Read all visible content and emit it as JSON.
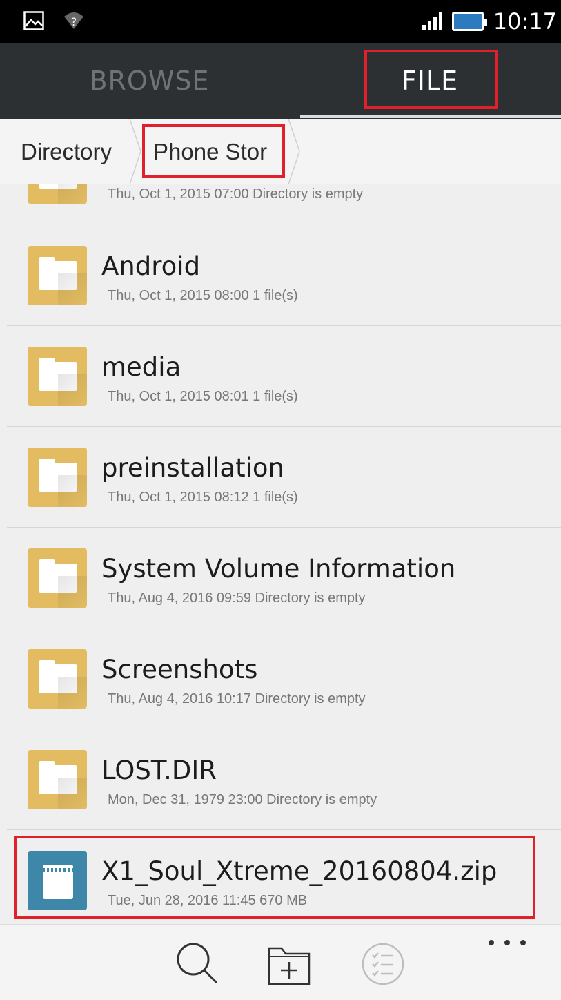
{
  "status_bar": {
    "time": "10:17",
    "left_icons": [
      "image-icon",
      "wifi-unknown-icon"
    ],
    "right_icons": [
      "signal-icon",
      "battery-charging-icon"
    ],
    "battery_color": "#2c7bbf"
  },
  "tabs": [
    {
      "label": "BROWSE",
      "active": false
    },
    {
      "label": "FILE",
      "active": true
    }
  ],
  "breadcrumb": [
    "Directory",
    "Phone Stor"
  ],
  "files": [
    {
      "name": "",
      "meta": "Thu, Oct 1, 2015 07:00  Directory is empty",
      "type": "folder"
    },
    {
      "name": "Android",
      "meta": "Thu, Oct 1, 2015 08:00  1 file(s)",
      "type": "folder"
    },
    {
      "name": "media",
      "meta": "Thu, Oct 1, 2015 08:01  1 file(s)",
      "type": "folder"
    },
    {
      "name": "preinstallation",
      "meta": "Thu, Oct 1, 2015 08:12  1 file(s)",
      "type": "folder"
    },
    {
      "name": "System Volume Information",
      "meta": "Thu, Aug 4, 2016 09:59  Directory is empty",
      "type": "folder"
    },
    {
      "name": "Screenshots",
      "meta": "Thu, Aug 4, 2016 10:17  Directory is empty",
      "type": "folder"
    },
    {
      "name": "LOST.DIR",
      "meta": "Mon, Dec 31, 1979 23:00  Directory is empty",
      "type": "folder"
    },
    {
      "name": "X1_Soul_Xtreme_20160804.zip",
      "meta": "Tue, Jun 28, 2016 11:45  670 MB",
      "type": "zip"
    }
  ],
  "bottom_bar": {
    "icons": [
      "search-icon",
      "new-folder-icon",
      "multi-select-icon",
      "more-icon"
    ]
  },
  "colors": {
    "highlight": "#e0202a",
    "folder": "#e3bc62",
    "zip": "#3e87a8",
    "tab_bar": "#2d3033"
  }
}
